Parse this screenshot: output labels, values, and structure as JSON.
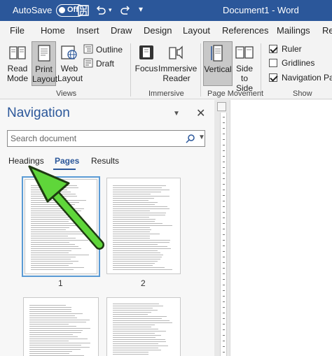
{
  "titlebar": {
    "autosave_label": "AutoSave",
    "autosave_state": "Off",
    "document_title": "Document1 - Word"
  },
  "ribbon_tabs": [
    "File",
    "Home",
    "Insert",
    "Draw",
    "Design",
    "Layout",
    "References",
    "Mailings",
    "Re"
  ],
  "views_group": {
    "read_mode": "Read Mode",
    "print_layout": "Print Layout",
    "web_layout": "Web Layout",
    "outline": "Outline",
    "draft": "Draft",
    "label": "Views"
  },
  "immersive_group": {
    "focus": "Focus",
    "immersive_reader": "Immersive Reader",
    "label": "Immersive"
  },
  "page_movement_group": {
    "vertical": "Vertical",
    "side_to_side": "Side to Side",
    "label": "Page Movement"
  },
  "show_group": {
    "ruler": {
      "label": "Ruler",
      "checked": true
    },
    "gridlines": {
      "label": "Gridlines",
      "checked": false
    },
    "navigation_pane": {
      "label": "Navigation Pane",
      "checked": true
    },
    "label": "Show"
  },
  "navigation": {
    "title": "Navigation",
    "search_placeholder": "Search document",
    "tabs": [
      "Headings",
      "Pages",
      "Results"
    ],
    "active_tab": "Pages",
    "pages": [
      "1",
      "2"
    ],
    "selected_page": "1"
  },
  "colors": {
    "title_bar": "#2b579a",
    "accent": "#2b579a",
    "arrow": "#5fd63a"
  }
}
